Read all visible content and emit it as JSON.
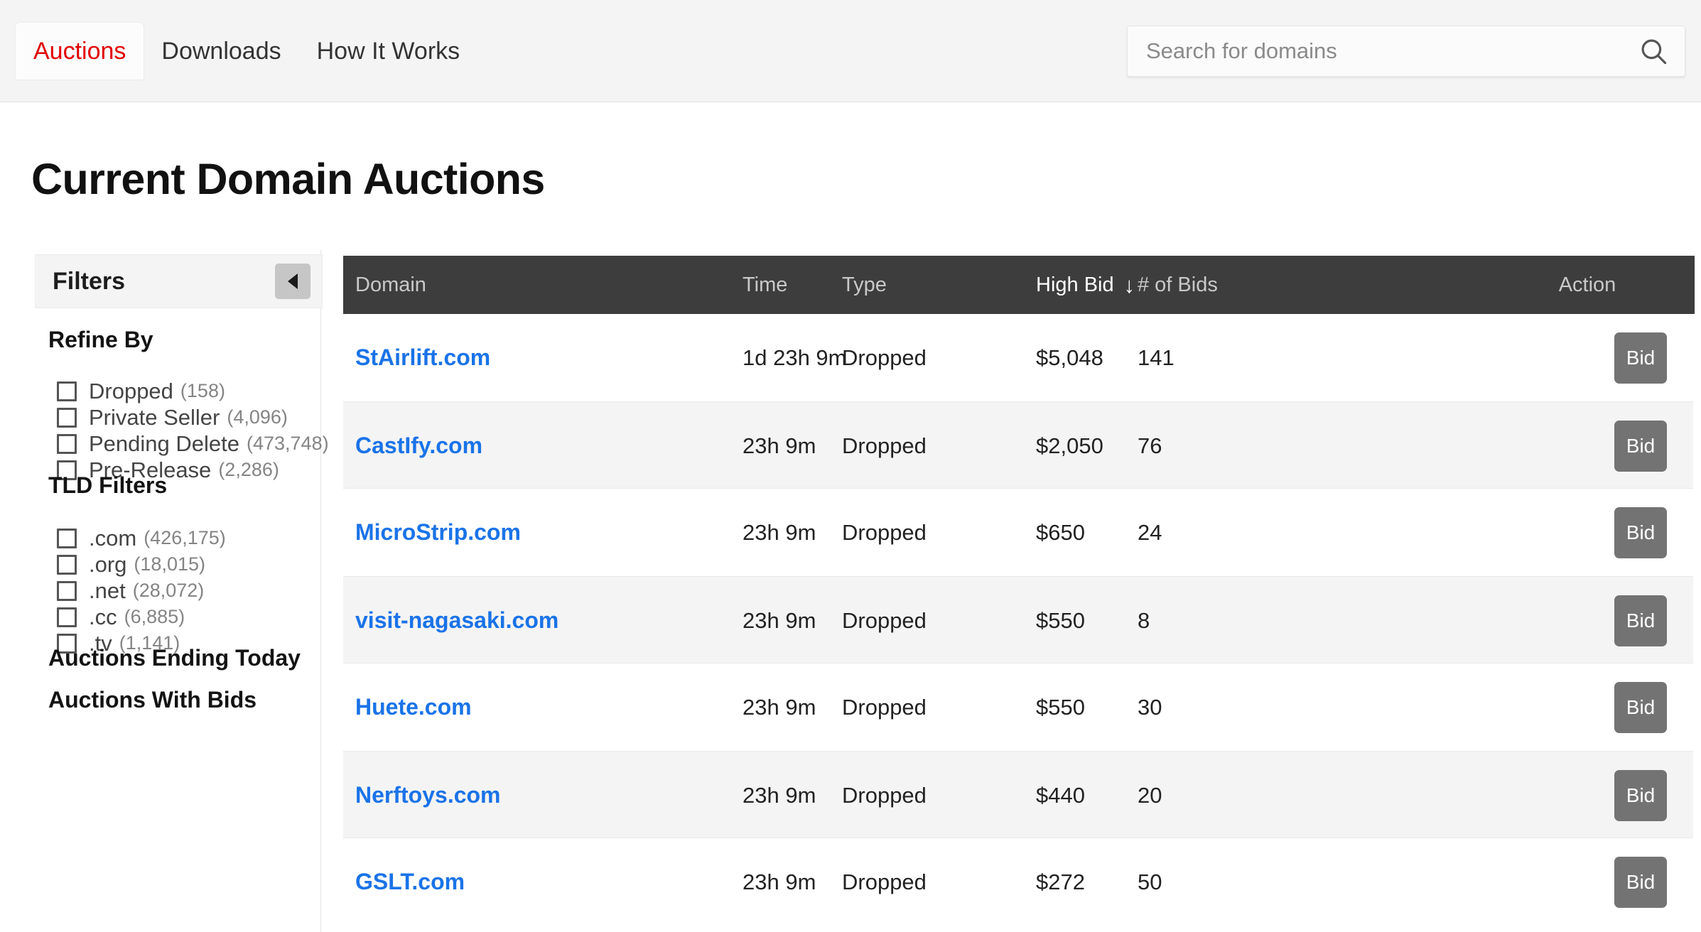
{
  "nav": {
    "tabs": [
      {
        "label": "Auctions",
        "active": true
      },
      {
        "label": "Downloads",
        "active": false
      },
      {
        "label": "How It Works",
        "active": false
      }
    ],
    "search": {
      "placeholder": "Search for domains",
      "value": "",
      "icon": "search-icon"
    }
  },
  "page": {
    "title": "Current Domain Auctions"
  },
  "sidebar": {
    "panel_title": "Filters",
    "collapse_icon": "chevron-left-icon",
    "sections": [
      {
        "title": "Refine By",
        "items": [
          {
            "label": "Dropped",
            "count": "(158)",
            "checked": false
          },
          {
            "label": "Private Seller",
            "count": "(4,096)",
            "checked": false
          },
          {
            "label": "Pending Delete",
            "count": "(473,748)",
            "checked": false
          },
          {
            "label": "Pre-Release",
            "count": "(2,286)",
            "checked": false
          }
        ]
      },
      {
        "title": "TLD Filters",
        "items": [
          {
            "label": ".com",
            "count": "(426,175)",
            "checked": false
          },
          {
            "label": ".org",
            "count": "(18,015)",
            "checked": false
          },
          {
            "label": ".net",
            "count": "(28,072)",
            "checked": false
          },
          {
            "label": ".cc",
            "count": "(6,885)",
            "checked": false
          },
          {
            "label": ".tv",
            "count": "(1,141)",
            "checked": false
          }
        ]
      }
    ],
    "links": [
      {
        "label": "Auctions Ending Today"
      },
      {
        "label": "Auctions With Bids"
      }
    ]
  },
  "table": {
    "columns": [
      {
        "key": "domain",
        "label": "Domain",
        "sorted": false
      },
      {
        "key": "time",
        "label": "Time",
        "sorted": false
      },
      {
        "key": "type",
        "label": "Type",
        "sorted": false
      },
      {
        "key": "highbid",
        "label": "High Bid",
        "sorted": true,
        "sort_dir": "↓"
      },
      {
        "key": "bids",
        "label": "# of Bids",
        "sorted": false
      },
      {
        "key": "action",
        "label": "Action",
        "sorted": false
      }
    ],
    "action_label": "Bid",
    "rows": [
      {
        "domain": "StAirlift.com",
        "time": "1d 23h 9m",
        "type": "Dropped",
        "high_bid": "$5,048",
        "bids": "141"
      },
      {
        "domain": "CastIfy.com",
        "time": "23h 9m",
        "type": "Dropped",
        "high_bid": "$2,050",
        "bids": "76"
      },
      {
        "domain": "MicroStrip.com",
        "time": "23h 9m",
        "type": "Dropped",
        "high_bid": "$650",
        "bids": "24"
      },
      {
        "domain": "visit-nagasaki.com",
        "time": "23h 9m",
        "type": "Dropped",
        "high_bid": "$550",
        "bids": "8"
      },
      {
        "domain": "Huete.com",
        "time": "23h 9m",
        "type": "Dropped",
        "high_bid": "$550",
        "bids": "30"
      },
      {
        "domain": "Nerftoys.com",
        "time": "23h 9m",
        "type": "Dropped",
        "high_bid": "$440",
        "bids": "20"
      },
      {
        "domain": "GSLT.com",
        "time": "23h 9m",
        "type": "Dropped",
        "high_bid": "$272",
        "bids": "50"
      }
    ]
  },
  "colors": {
    "accent_red": "#e00000",
    "link_blue": "#1a73e8",
    "header_dark": "#3d3d3d",
    "button_gray": "#737373",
    "stripe": "#f4f4f4"
  }
}
